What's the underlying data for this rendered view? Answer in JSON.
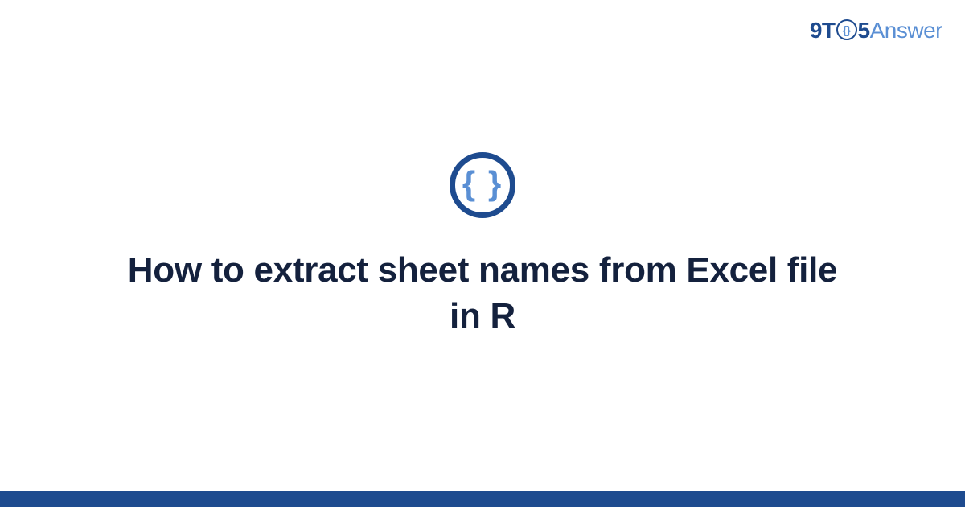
{
  "logo": {
    "part_9t": "9T",
    "braces_small": "{}",
    "part_5": "5",
    "part_answer": "Answer"
  },
  "icon": {
    "braces": "{ }"
  },
  "title": "How to extract sheet names from Excel file in R",
  "colors": {
    "dark_blue": "#1e4b8f",
    "light_blue": "#5a8fd4",
    "title_color": "#14213d"
  }
}
